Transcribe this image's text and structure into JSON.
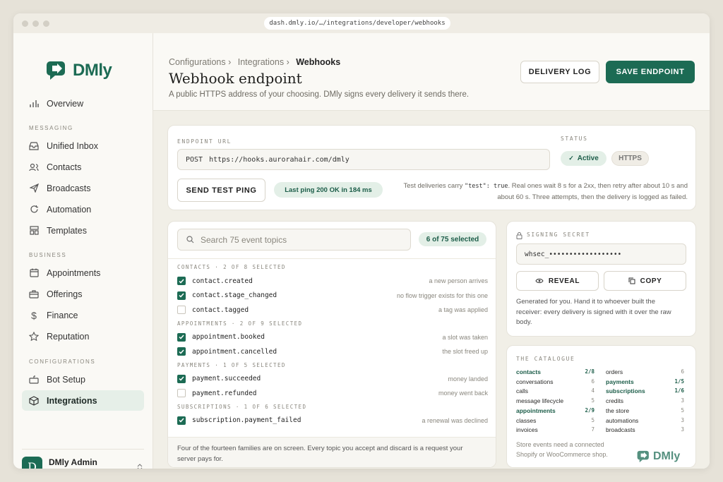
{
  "browser": {
    "url": "dash.dmly.io/…/integrations/developer/webhooks"
  },
  "brand": {
    "name": "DMly",
    "color": "#1c6b54"
  },
  "sidebar": {
    "overview": "Overview",
    "sections": {
      "messaging": "MESSAGING",
      "business": "BUSINESS",
      "configurations": "CONFIGURATIONS"
    },
    "items": {
      "unified_inbox": "Unified Inbox",
      "contacts": "Contacts",
      "broadcasts": "Broadcasts",
      "automation": "Automation",
      "templates": "Templates",
      "appointments": "Appointments",
      "offerings": "Offerings",
      "finance": "Finance",
      "reputation": "Reputation",
      "bot_setup": "Bot Setup",
      "integrations": "Integrations"
    },
    "user": {
      "initial": "D",
      "name": "DMly Admin",
      "role": "DMly"
    }
  },
  "header": {
    "crumb1": "Configurations",
    "crumb2": "Integrations",
    "crumb3": "Webhooks",
    "sep": "›",
    "title": "Webhook endpoint",
    "subtitle": "A public HTTPS address of your choosing. DMly signs every delivery it sends there.",
    "delivery_log": "DELIVERY LOG",
    "save": "SAVE ENDPOINT"
  },
  "endpoint": {
    "label": "ENDPOINT URL",
    "method": "POST",
    "url": "https://hooks.aurorahair.com/dmly",
    "status_label": "STATUS",
    "status_active": "Active",
    "status_https": "HTTPS",
    "test_button": "SEND TEST PING",
    "last_ping": "Last ping 200 OK in 184 ms",
    "note_prefix": "Test deliveries carry",
    "note_code": "\"test\": true",
    "note_suffix": ". Real ones wait 8 s for a 2xx, then retry after about 10 s and",
    "note_line2": "about 60 s. Three attempts, then the delivery is logged as failed."
  },
  "topics": {
    "search_placeholder": "Search 75 event topics",
    "selected_badge": "6 of 75 selected",
    "groups": [
      {
        "heading": "CONTACTS · 2 OF 8 SELECTED",
        "rows": [
          {
            "name": "contact.created",
            "desc": "a new person arrives",
            "checked": true
          },
          {
            "name": "contact.stage_changed",
            "desc": "no flow trigger exists for this one",
            "checked": true
          },
          {
            "name": "contact.tagged",
            "desc": "a tag was applied",
            "checked": false
          }
        ]
      },
      {
        "heading": "APPOINTMENTS · 2 OF 9 SELECTED",
        "rows": [
          {
            "name": "appointment.booked",
            "desc": "a slot was taken",
            "checked": true
          },
          {
            "name": "appointment.cancelled",
            "desc": "the slot freed up",
            "checked": true
          }
        ]
      },
      {
        "heading": "PAYMENTS · 1 OF 5 SELECTED",
        "rows": [
          {
            "name": "payment.succeeded",
            "desc": "money landed",
            "checked": true
          },
          {
            "name": "payment.refunded",
            "desc": "money went back",
            "checked": false
          }
        ]
      },
      {
        "heading": "SUBSCRIPTIONS · 1 OF 6 SELECTED",
        "rows": [
          {
            "name": "subscription.payment_failed",
            "desc": "a renewal was declined",
            "checked": true
          }
        ]
      }
    ],
    "footer_line1": "Four of the fourteen families are on screen. Every topic you accept and discard is a request your",
    "footer_line2": "server pays for."
  },
  "secret": {
    "label": "SIGNING SECRET",
    "value": "whsec_••••••••••••••••••",
    "reveal": "REVEAL",
    "copy": "COPY",
    "note_line1": "Generated for you. Hand it to whoever built the",
    "note_line2": "receiver: every delivery is signed with it over the raw",
    "note_line3": "body."
  },
  "catalogue": {
    "label": "THE CATALOGUE",
    "left": [
      {
        "name": "contacts",
        "count": "2/8",
        "bold": true
      },
      {
        "name": "conversations",
        "count": "6",
        "bold": false
      },
      {
        "name": "calls",
        "count": "4",
        "bold": false
      },
      {
        "name": "message lifecycle",
        "count": "5",
        "bold": false
      },
      {
        "name": "appointments",
        "count": "2/9",
        "bold": true
      },
      {
        "name": "classes",
        "count": "5",
        "bold": false
      },
      {
        "name": "invoices",
        "count": "7",
        "bold": false
      }
    ],
    "right": [
      {
        "name": "orders",
        "count": "6",
        "bold": false
      },
      {
        "name": "payments",
        "count": "1/5",
        "bold": true
      },
      {
        "name": "subscriptions",
        "count": "1/6",
        "bold": true
      },
      {
        "name": "credits",
        "count": "3",
        "bold": false
      },
      {
        "name": "the store",
        "count": "5",
        "bold": false
      },
      {
        "name": "automations",
        "count": "3",
        "bold": false
      },
      {
        "name": "broadcasts",
        "count": "3",
        "bold": false
      }
    ],
    "note_line1": "Store events need a connected",
    "note_line2": "Shopify or WooCommerce shop."
  }
}
